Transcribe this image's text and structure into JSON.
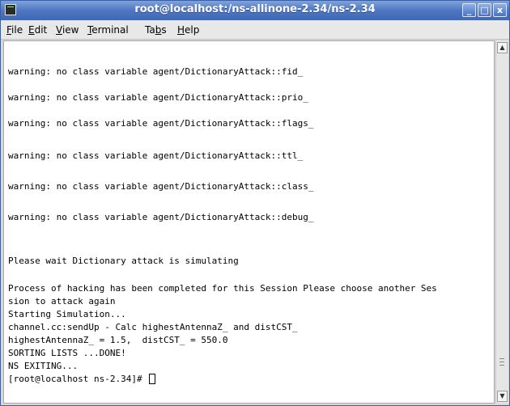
{
  "window": {
    "title": "root@localhost:/ns-allinone-2.34/ns-2.34",
    "minimize_glyph": "_",
    "maximize_glyph": "□",
    "close_glyph": "x"
  },
  "menubar": {
    "items": [
      {
        "pre": "",
        "u": "F",
        "post": "ile"
      },
      {
        "pre": "",
        "u": "E",
        "post": "dit"
      },
      {
        "pre": "",
        "u": "V",
        "post": "iew"
      },
      {
        "pre": "",
        "u": "T",
        "post": "erminal"
      },
      {
        "pre": "Ta",
        "u": "b",
        "post": "s"
      },
      {
        "pre": "",
        "u": "H",
        "post": "elp"
      }
    ]
  },
  "terminal": {
    "lines": [
      "warning: no class variable agent/DictionaryAttack::fid_",
      "",
      "warning: no class variable agent/DictionaryAttack::prio_",
      "",
      "warning: no class variable agent/DictionaryAttack::flags_",
      "",
      "warning: no class variable agent/DictionaryAttack::ttl_",
      "",
      "warning: no class variable agent/DictionaryAttack::class_",
      "",
      "warning: no class variable agent/DictionaryAttack::debug_",
      "",
      "",
      "Please wait Dictionary attack is simulating",
      "",
      "Process of hacking has been completed for this Session Please choose another Ses",
      "sion to attack again",
      "Starting Simulation...",
      "channel.cc:sendUp - Calc highestAntennaZ_ and distCST_",
      "highestAntennaZ_ = 1.5,  distCST_ = 550.0",
      "SORTING LISTS ...DONE!",
      "NS EXITING...",
      "[root@localhost ns-2.34]# "
    ]
  },
  "scrollbar": {
    "up_glyph": "▲",
    "down_glyph": "▼"
  }
}
